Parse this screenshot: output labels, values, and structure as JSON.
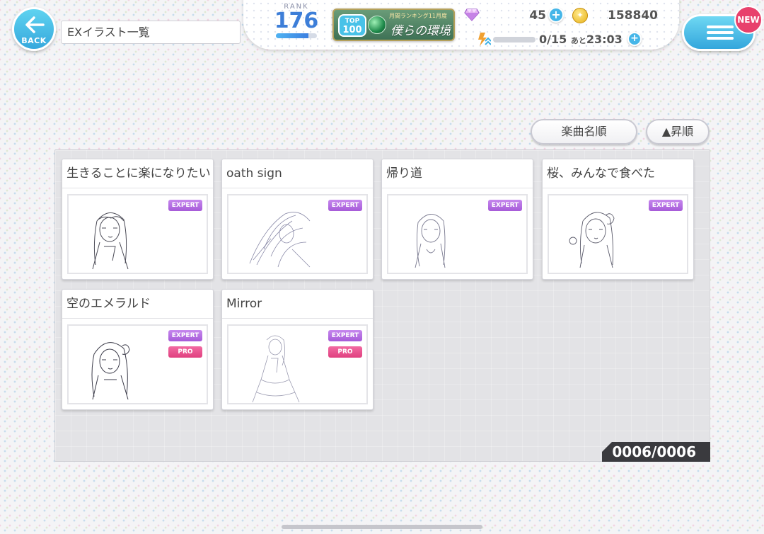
{
  "header": {
    "back_label": "BACK",
    "page_title": "EXイラスト一覧"
  },
  "status": {
    "rank_label": "RANK",
    "rank_value": "176",
    "rank_progress": 0.8,
    "ranking_badge": {
      "top_line1": "TOP",
      "top_line2": "100",
      "subtitle": "月間ランキング11月度",
      "song": "僕らの環境"
    },
    "gems": "45",
    "coins": "158840",
    "stamina": "0/15",
    "stamina_timer_prefix": "あと",
    "stamina_timer": "23:03",
    "plus_symbol": "+"
  },
  "menu": {
    "new_badge": "NEW"
  },
  "sort": {
    "order_label": "楽曲名順",
    "direction_label": "▲昇順"
  },
  "cards": [
    {
      "title": "生きることに楽になりたい",
      "tags": [
        "EXPERT"
      ]
    },
    {
      "title": "oath sign",
      "tags": [
        "EXPERT"
      ]
    },
    {
      "title": "帰り道",
      "tags": [
        "EXPERT"
      ]
    },
    {
      "title": "桜、みんなで食べた",
      "tags": [
        "EXPERT"
      ]
    },
    {
      "title": "空のエメラルド",
      "tags": [
        "EXPERT",
        "PRO"
      ]
    },
    {
      "title": "Mirror",
      "tags": [
        "EXPERT",
        "PRO"
      ]
    }
  ],
  "counter": "0006/0006",
  "icons": {
    "back": "arrow-left-icon",
    "gem": "diamond-icon",
    "coin": "coin-icon",
    "stamina": "stamina-icon",
    "menu": "hamburger-icon"
  },
  "colors": {
    "accent_blue": "#36a8dd",
    "expert_tag": "#a65bd8",
    "pro_tag": "#e0407f",
    "new_badge": "#e8416c"
  }
}
